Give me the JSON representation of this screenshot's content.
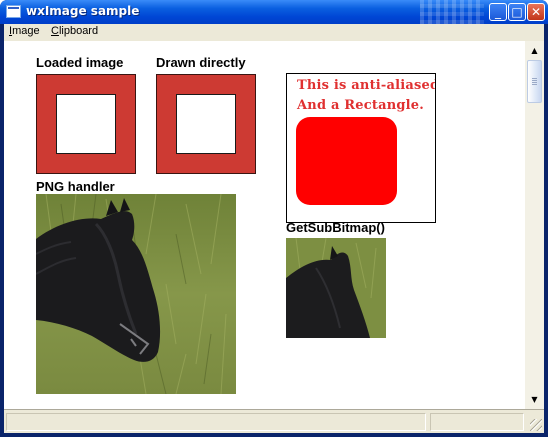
{
  "window": {
    "title": "wxImage sample",
    "controls": {
      "minimize": "_",
      "maximize": "□",
      "close": "✕"
    },
    "accent": "#0a5fe0"
  },
  "menubar": {
    "items": [
      {
        "label": "Image",
        "mnemonic": "I"
      },
      {
        "label": "Clipboard",
        "mnemonic": "C"
      }
    ]
  },
  "canvas": {
    "loaded_label": "Loaded image",
    "drawn_label": "Drawn directly",
    "png_label": "PNG handler",
    "subbitmap_label": "GetSubBitmap()",
    "antialias": {
      "line1": "This is anti-aliased Text.",
      "line2": "And a Rectangle.",
      "text_color": "#e03030",
      "rect_color": "#ff0000"
    },
    "frame_color": "#cd3a33"
  },
  "scrollbar": {
    "up_icon": "▲",
    "down_icon": "▼"
  },
  "statusbar": {
    "text": ""
  }
}
